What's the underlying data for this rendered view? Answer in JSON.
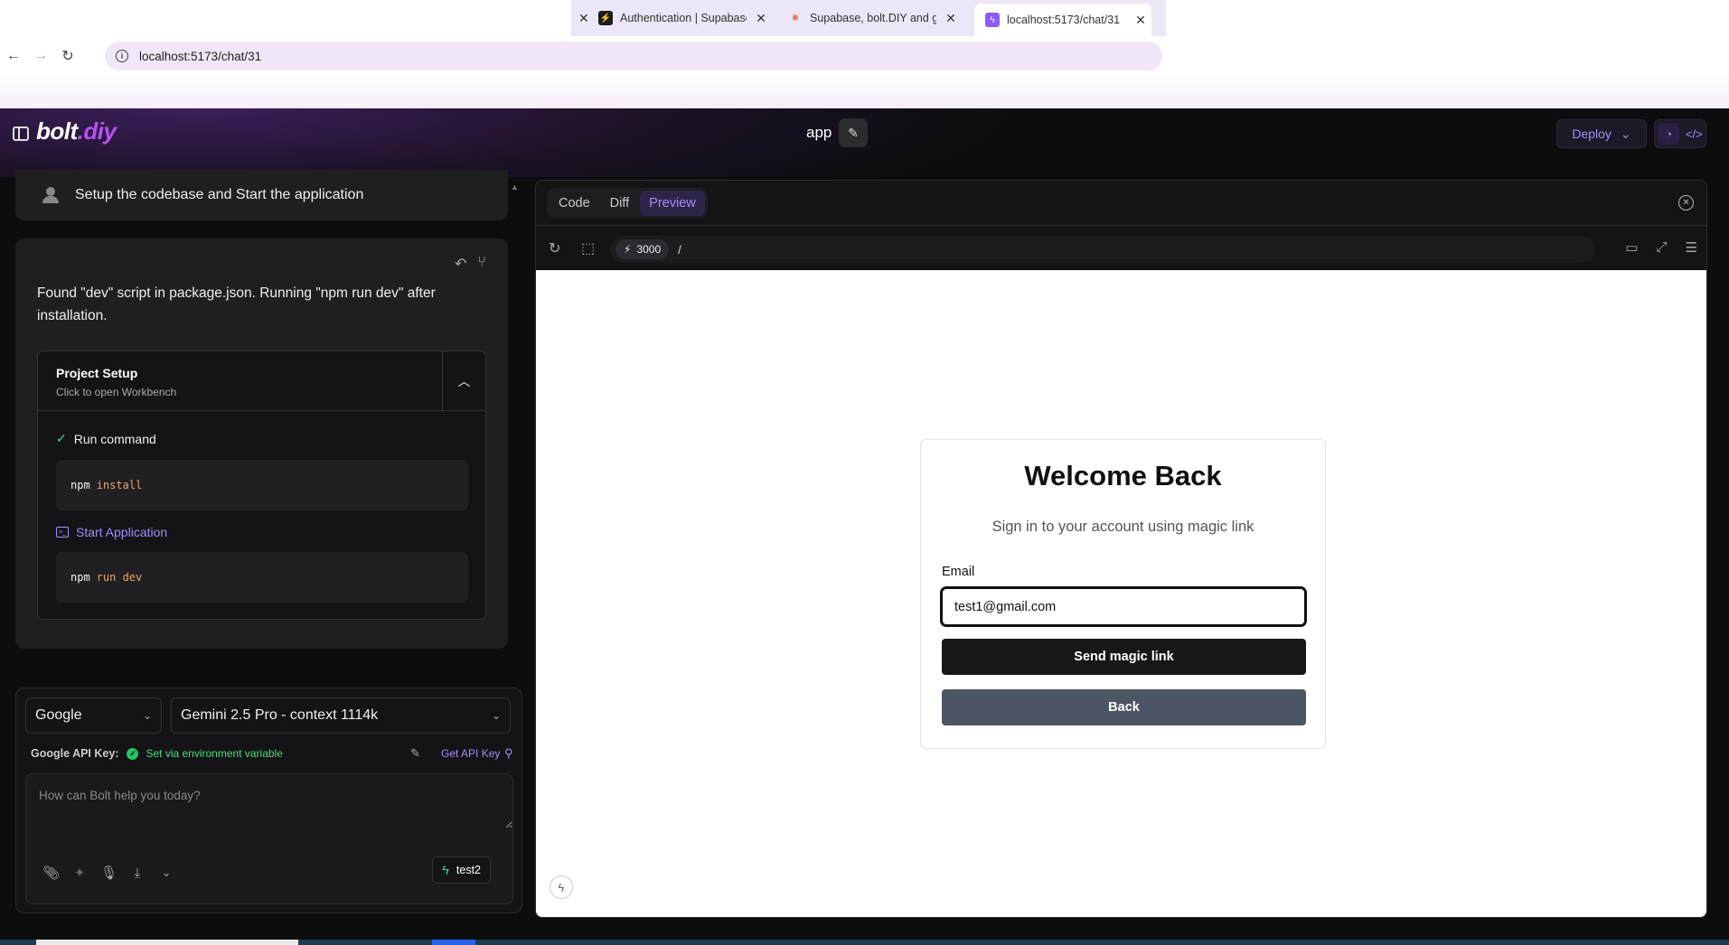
{
  "browser": {
    "tabs": [
      {
        "title": "Authentication | Supabase",
        "favicon": "supabase-icon"
      },
      {
        "title": "Supabase, bolt.DIY and gi",
        "favicon": "claude-icon"
      },
      {
        "title": "localhost:5173/chat/31",
        "favicon": "bolt-icon"
      }
    ],
    "url": "localhost:5173/chat/31"
  },
  "header": {
    "logo_main": "bolt",
    "logo_accent": ".diy",
    "title": "app",
    "deploy_label": "Deploy"
  },
  "chat": {
    "user_message": "Setup the codebase and Start the application",
    "assistant_message": "Found \"dev\" script in package.json. Running \"npm run dev\" after installation.",
    "artifact": {
      "title": "Project Setup",
      "subtitle": "Click to open Workbench",
      "actions": [
        {
          "label": "Run command",
          "cmd": "npm",
          "args": "install"
        },
        {
          "label": "Start Application",
          "cmd": "npm",
          "args": "run dev"
        }
      ]
    }
  },
  "input": {
    "provider": "Google",
    "model": "Gemini 2.5 Pro - context 1114k",
    "apikey_label": "Google API Key:",
    "apikey_status": "Set via environment variable",
    "apikey_link": "Get API Key",
    "placeholder": "How can Bolt help you today?",
    "template_label": "test2"
  },
  "workbench": {
    "tabs": [
      "Code",
      "Diff",
      "Preview"
    ],
    "active_tab": "Preview",
    "port": "3000",
    "path": "/"
  },
  "preview": {
    "title": "Welcome Back",
    "subtitle": "Sign in to your account using magic link",
    "email_label": "Email",
    "email_value": "test1@gmail.com",
    "send_label": "Send magic link",
    "back_label": "Back"
  },
  "colors": {
    "accent": "#a78bfa",
    "brand": "#b452f5",
    "success": "#22c55e",
    "background": "#0d0d0f"
  }
}
